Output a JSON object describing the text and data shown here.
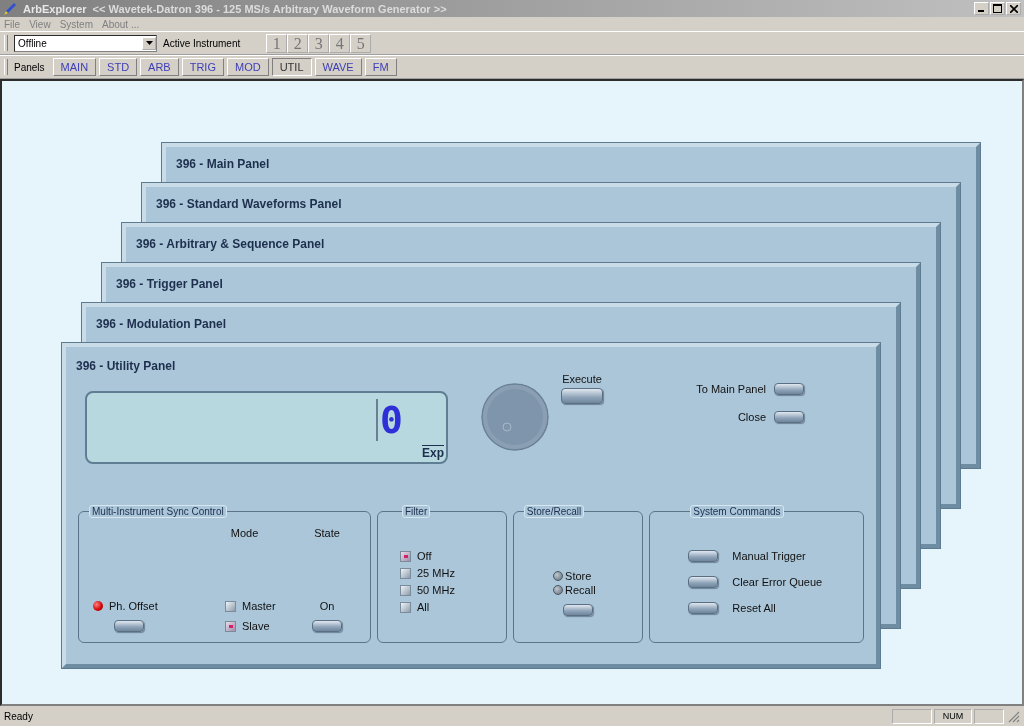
{
  "window": {
    "app": "ArbExplorer",
    "title": "<< Wavetek-Datron 396 - 125 MS/s Arbitrary Waveform Generator >>"
  },
  "menu": [
    "File",
    "View",
    "System",
    "About ..."
  ],
  "toolbar": {
    "instrument": "Offline",
    "label": "Active Instrument",
    "instruments": [
      {
        "label": "1",
        "disabled": true
      },
      {
        "label": "2",
        "disabled": true
      },
      {
        "label": "3",
        "disabled": true
      },
      {
        "label": "4",
        "disabled": true
      },
      {
        "label": "5",
        "disabled": true
      }
    ]
  },
  "panels_bar": {
    "label": "Panels",
    "tabs": [
      {
        "label": "MAIN",
        "selected": false
      },
      {
        "label": "STD",
        "selected": false
      },
      {
        "label": "ARB",
        "selected": false
      },
      {
        "label": "TRIG",
        "selected": false
      },
      {
        "label": "MOD",
        "selected": false
      },
      {
        "label": "UTIL",
        "selected": true
      },
      {
        "label": "WAVE",
        "selected": false
      },
      {
        "label": "FM",
        "selected": false
      }
    ]
  },
  "panels": [
    {
      "title": "396 - Main Panel"
    },
    {
      "title": "396 - Standard Waveforms Panel"
    },
    {
      "title": "396 - Arbitrary & Sequence Panel"
    },
    {
      "title": "396 - Trigger Panel"
    },
    {
      "title": "396 - Modulation Panel"
    },
    {
      "title": "396 - Utility Panel"
    }
  ],
  "utility": {
    "display": {
      "value": "0",
      "unit": "Exp"
    },
    "execute": "Execute",
    "side_buttons": [
      "To Main Panel",
      "Close"
    ],
    "sync": {
      "title": "Multi-Instrument Sync Control",
      "mode_header": "Mode",
      "state_header": "State",
      "phase_offset": {
        "label": "Ph. Offset",
        "on": true
      },
      "modes": [
        {
          "label": "Master",
          "selected": false
        },
        {
          "label": "Slave",
          "selected": true
        }
      ],
      "state": "On"
    },
    "filter": {
      "title": "Filter",
      "options": [
        {
          "label": "Off",
          "selected": true
        },
        {
          "label": "25 MHz",
          "selected": false
        },
        {
          "label": "50 MHz",
          "selected": false
        },
        {
          "label": "All",
          "selected": false
        }
      ]
    },
    "store_recall": {
      "title": "Store/Recall",
      "options": [
        {
          "label": "Store",
          "selected": false
        },
        {
          "label": "Recall",
          "selected": false
        }
      ]
    },
    "system": {
      "title": "System Commands",
      "commands": [
        "Manual Trigger",
        "Clear Error Queue",
        "Reset All"
      ]
    }
  },
  "status_bar": {
    "text": "Ready",
    "num": "NUM"
  }
}
